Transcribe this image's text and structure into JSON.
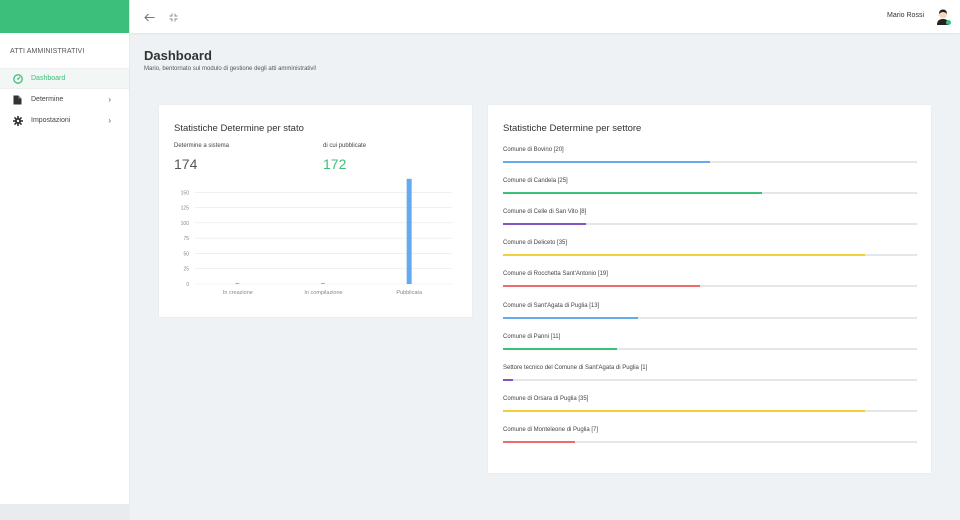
{
  "sidebar": {
    "section_title": "ATTI AMMINISTRATIVI",
    "items": [
      {
        "label": "Dashboard",
        "icon": "dashboard-icon",
        "active": true
      },
      {
        "label": "Determine",
        "icon": "file-icon",
        "active": false
      },
      {
        "label": "Impostazioni",
        "icon": "gear-icon",
        "active": false
      }
    ]
  },
  "topbar": {
    "user_name": "Mario Rossi",
    "back_icon": "arrow-left-icon",
    "fullscreen_icon": "compress-icon",
    "avatar_icon": "user-avatar-icon"
  },
  "header": {
    "title": "Dashboard",
    "subtitle": "Mario, bentornato sul modulo di gestione degli atti amministrativi!"
  },
  "stato_card": {
    "title": "Statistiche Determine per stato",
    "total_label": "Determine a sistema",
    "total_value": "174",
    "published_label": "di cui pubblicate",
    "published_value": "172"
  },
  "chart_data": {
    "type": "bar",
    "categories": [
      "In creazione",
      "In compilazione",
      "Pubblicata"
    ],
    "values": [
      1,
      1,
      172
    ],
    "yticks": [
      "0",
      "25",
      "50",
      "75",
      "100",
      "125",
      "150"
    ],
    "ylim": [
      0,
      175
    ],
    "grid": true,
    "bar_color": "#64aaee"
  },
  "settore_card": {
    "title": "Statistiche Determine per settore",
    "max": 40,
    "sectors": [
      {
        "label": "Comune di Bovino [20]",
        "value": 20,
        "color": "#64aaee"
      },
      {
        "label": "Comune di Candela [25]",
        "value": 25,
        "color": "#3cbf7a"
      },
      {
        "label": "Comune di Celle di San Vito [8]",
        "value": 8,
        "color": "#7e57c2"
      },
      {
        "label": "Comune di Deliceto [35]",
        "value": 35,
        "color": "#f2cf3c"
      },
      {
        "label": "Comune di Rocchetta Sant'Antonio [19]",
        "value": 19,
        "color": "#ef6a6a"
      },
      {
        "label": "Comune di Sant'Agata di Puglia [13]",
        "value": 13,
        "color": "#64aaee"
      },
      {
        "label": "Comune di Panni [11]",
        "value": 11,
        "color": "#3cbf7a"
      },
      {
        "label": "Settore tecnico del Comune di Sant'Agata di Puglia [1]",
        "value": 1,
        "color": "#7e57c2"
      },
      {
        "label": "Comune di Orsara di Puglia [35]",
        "value": 35,
        "color": "#f2cf3c"
      },
      {
        "label": "Comune di Monteleone di Puglia [7]",
        "value": 7,
        "color": "#ef6a6a"
      }
    ]
  }
}
